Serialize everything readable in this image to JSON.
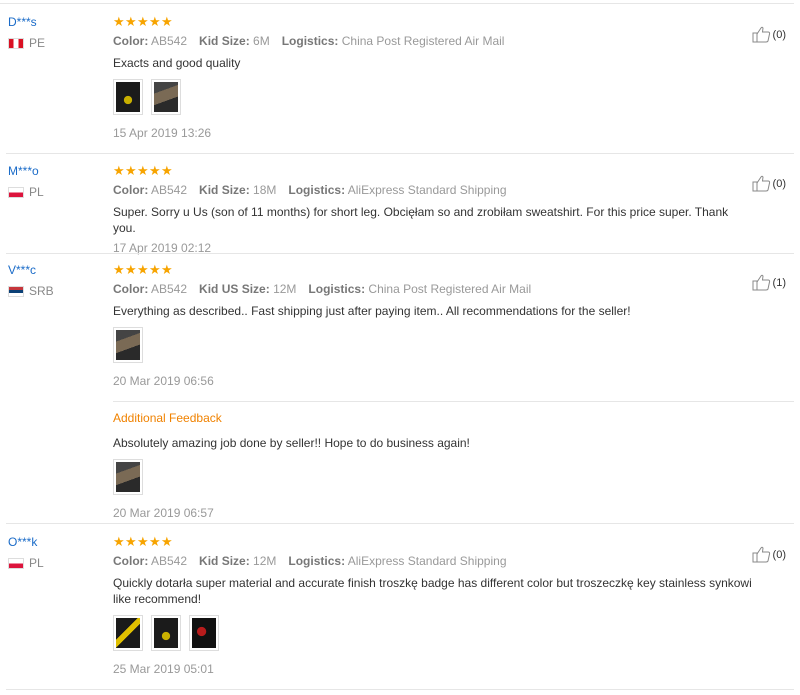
{
  "reviews": [
    {
      "user": "D***s",
      "country": "PE",
      "rating": 5,
      "color_label": "Color:",
      "color_value": "AB542",
      "size_label": "Kid Size:",
      "size_value": "6M",
      "logistics_label": "Logistics:",
      "logistics_value": "China Post Registered Air Mail",
      "text": "Exacts and good quality",
      "photos": [
        "img-a",
        "img-b"
      ],
      "date": "15 Apr 2019 13:26",
      "likes": "(0)"
    },
    {
      "user": "M***o",
      "country": "PL",
      "rating": 5,
      "color_label": "Color:",
      "color_value": "AB542",
      "size_label": "Kid Size:",
      "size_value": "18M",
      "logistics_label": "Logistics:",
      "logistics_value": "AliExpress Standard Shipping",
      "text": "Super. Sorry u Us (son of 11 months) for short leg. Obcięłam so and zrobiłam sweatshirt. For this price super. Thank you.",
      "photos": [],
      "date": "17 Apr 2019 02:12",
      "likes": "(0)"
    },
    {
      "user": "V***c",
      "country": "SRB",
      "rating": 5,
      "color_label": "Color:",
      "color_value": "AB542",
      "size_label": "Kid US Size:",
      "size_value": "12M",
      "logistics_label": "Logistics:",
      "logistics_value": "China Post Registered Air Mail",
      "text": "Everything as described.. Fast shipping just after paying item.. All recommendations for the seller!",
      "photos": [
        "img-b"
      ],
      "date": "20 Mar 2019 06:56",
      "additional_label": "Additional Feedback",
      "additional_text": "Absolutely amazing job done by seller!! Hope to do business again!",
      "additional_photos": [
        "img-b"
      ],
      "additional_date": "20 Mar 2019 06:57",
      "likes": "(1)"
    },
    {
      "user": "O***k",
      "country": "PL",
      "rating": 5,
      "color_label": "Color:",
      "color_value": "AB542",
      "size_label": "Kid Size:",
      "size_value": "12M",
      "logistics_label": "Logistics:",
      "logistics_value": "AliExpress Standard Shipping",
      "text": "Quickly dotarła super material and accurate finish troszkę badge has different color but troszeczkę key stainless synkowi like recommend!",
      "photos": [
        "img-c",
        "img-a",
        "img-d"
      ],
      "date": "25 Mar 2019 05:01",
      "likes": "(0)"
    }
  ],
  "icons": {
    "star": "star-icon",
    "thumb": "thumbs-up-icon"
  },
  "colors": {
    "username": "#1a6bc8",
    "star": "#f7a400",
    "additional": "#f08200"
  }
}
